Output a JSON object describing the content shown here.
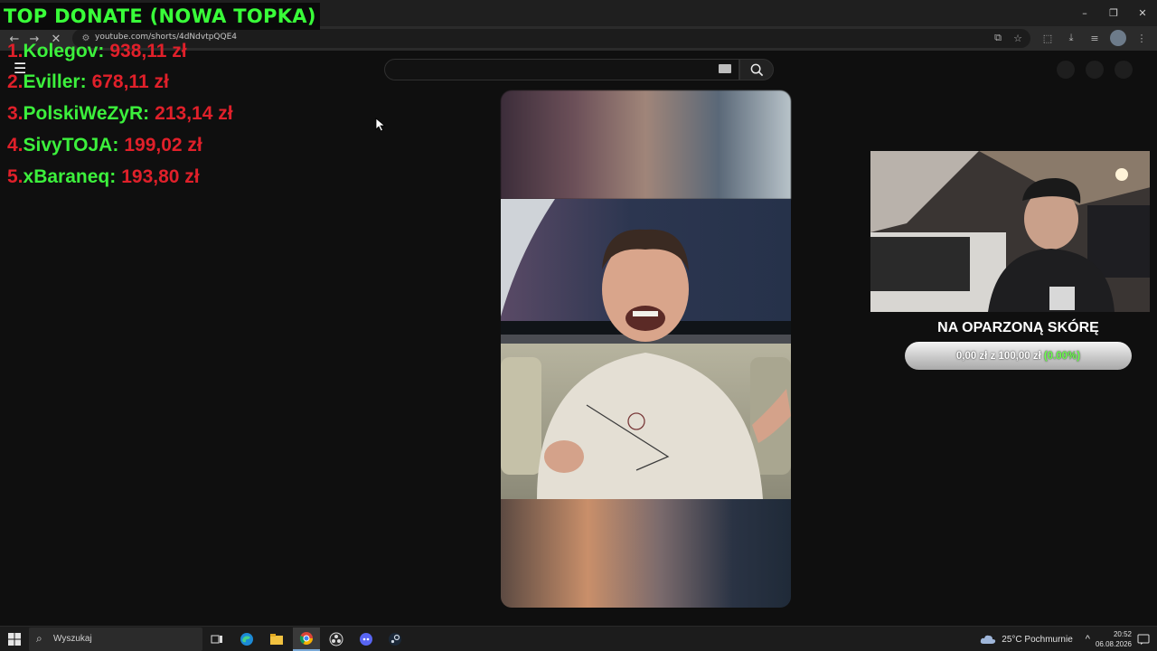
{
  "browser": {
    "url": "youtube.com/shorts/4dNdvtpQQE4",
    "window_controls": [
      "–",
      "❐",
      "✕"
    ]
  },
  "overlay": {
    "title": "TOP DONATE (NOWA TOPKA)",
    "donors": [
      {
        "rank": "1.",
        "name": "Kolegov",
        "amount": "938,11 zł"
      },
      {
        "rank": "2.",
        "name": "Eviller",
        "amount": "678,11 zł"
      },
      {
        "rank": "3.",
        "name": "PolskiWeZyR",
        "amount": "213,14 zł"
      },
      {
        "rank": "4.",
        "name": "SivyTOJA",
        "amount": "199,02 zł"
      },
      {
        "rank": "5.",
        "name": "xBaraneq",
        "amount": "193,80 zł"
      }
    ]
  },
  "goal": {
    "title": "NA OPARZONĄ SKÓRĘ",
    "progress_text": "0,00 zł z 100,00 zł",
    "percent_text": "(0.00%)",
    "progress": 0
  },
  "taskbar": {
    "search_placeholder": "Wyszukaj",
    "weather": "25°C  Pochmurnie",
    "time": "20:52",
    "date": "06.08.2026"
  },
  "colors": {
    "donor_name": "#3cf03c",
    "donor_amount": "#e0202a",
    "overlay_title": "#39ff39"
  }
}
